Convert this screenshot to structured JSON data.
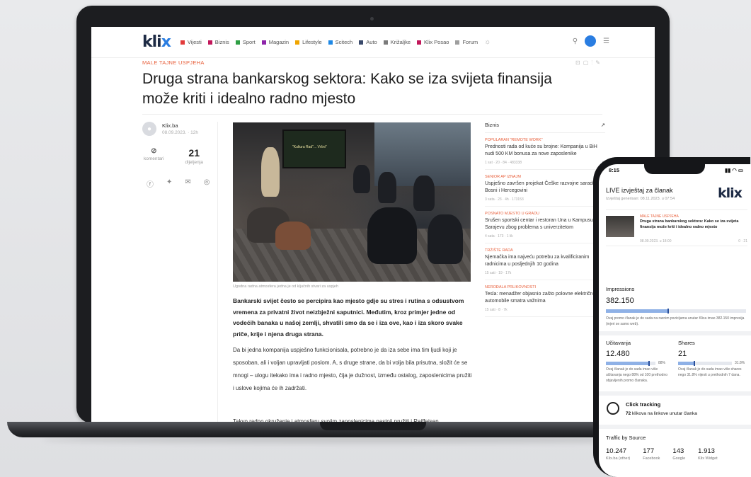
{
  "nav": {
    "logo_main": "kli",
    "logo_x": "x",
    "items": [
      {
        "label": "Vijesti",
        "color": "#e23b3b"
      },
      {
        "label": "Biznis",
        "color": "#c2185b"
      },
      {
        "label": "Sport",
        "color": "#2e9e44"
      },
      {
        "label": "Magazin",
        "color": "#8e24aa"
      },
      {
        "label": "Lifestyle",
        "color": "#f0a500"
      },
      {
        "label": "Scitech",
        "color": "#1e88e5"
      },
      {
        "label": "Auto",
        "color": "#3a4a6b"
      },
      {
        "label": "Križaljke",
        "color": "#7b7b7b"
      },
      {
        "label": "Klix Posao",
        "color": "#c2185b"
      },
      {
        "label": "Forum",
        "color": "#9e9e9e"
      }
    ]
  },
  "article": {
    "kicker": "MALE TAJNE USPJEHA",
    "headline": "Druga strana bankarskog sektora: Kako se iza svijeta finansija može kriti i idealno radno mjesto",
    "author": "Klix.ba",
    "date": "08.09.2023. · 12h",
    "comments_label": "komentari",
    "shares_count": "21",
    "shares_label": "dijeljenja",
    "photo_screen_text": "\"Kultura Rad\"... Vršni\"",
    "caption": "Ugodna radna atmosfera jedna je od ključnih stvari za uspjeh",
    "lead": "Bankarski svijet često se percipira kao mjesto gdje su stres i rutina s odsustvom vremena za privatni život neizbježni saputnici. Međutim, kroz primjer jedne od vodećih banaka u našoj zemlji, shvatili smo da se i iza ove, kao i iza skoro svake priče, krije i njena druga strana.",
    "body": "Da bi jedna kompanija uspješno funkcionisala, potrebno je da iza sebe ima tim ljudi koji je sposoban, ali i voljan upravljati poslom. A, s druge strane, da bi volja bila prisutna, složit će se mnogi – ulogu itekako ima i radno mjesto, čija je dužnost, između ostalog, zaposlenicima pružiti i uslove kojima će ih zadržati.",
    "body2": "Takvo radno okruženje i atmosferu svojim zaposlenicima nastoji pružiti i Raiffeisen"
  },
  "sidebar": {
    "title": "Biznis",
    "items": [
      {
        "kicker": "POPULARAN \"REMOTE WORK\"",
        "title": "Prednosti rada od kuće su brojne: Kompanija u BiH nudi 500 KM bonusa za nove zaposlenike",
        "meta": "1 sat · 20 · 84 · 483338"
      },
      {
        "kicker": "SENIOR AP IZNAJM",
        "title": "Uspješno završen projekat Češke razvojne saradnje u Bosni i Hercegovini",
        "meta": "3 sata · 23 · 4h · 173153"
      },
      {
        "kicker": "POSNATO MJESTO U GRADU",
        "title": "Srušen sportski centar i restoran Una u Kampusu u Sarajevu zbog problema s univerzitetom",
        "meta": "4 sata · 173 · 1 lik"
      },
      {
        "kicker": "TRŽIŠTE RADA",
        "title": "Njemačka ima najveću potrebu za kvalificiranim radnicima u posljednjih 10 godina",
        "meta": "15 sati · 19 · 17k"
      },
      {
        "kicker": "NEROĐALA PRLIKOVNOSTI",
        "title": "Tesla: menadžer objasnio zašto polovne električne automobile smatra važnima",
        "meta": "15 sati · 8 · 7k"
      }
    ]
  },
  "phone": {
    "time": "8:15",
    "title": "LIVE izvještaj za članak",
    "subtitle": "Izvještaj generisan: 08.11.2023. u 07:54",
    "logo": "klix",
    "card_kicker": "MALE TAJNE USPJEHA",
    "card_title": "Druga strana bankarskog sektora: Kako se iza svijeta finansija može kriti i idealno radno mjesto",
    "card_date": "08.09.2023. u 18:00",
    "card_count": "0 · 21",
    "impressions_label": "Impressions",
    "impressions_value": "382.150",
    "impressions_fill": 0.45,
    "impressions_note": "Ovaj promo članak je do sada na raznim pozicijama unutar Klixa imao 382.150 impresija (mjeri se samo web).",
    "loads_label": "Učitavanja",
    "loads_value": "12.480",
    "loads_fill": 0.88,
    "loads_pct": "88%",
    "loads_note": "Ovaj članak je do sada imao više učitavanja nego 88% od 100 prethodno objavljenih promo članaka.",
    "shares_label": "Shares",
    "shares_value": "21",
    "shares_fill": 0.318,
    "shares_pct": "31.8%",
    "shares_note": "Ovaj članak je do sada imao više shares nego 31.8% vijesti u prethodnih 7 dana.",
    "tracking_label": "Click tracking",
    "tracking_value": "72",
    "tracking_text": "klikova na linkove unutar članka",
    "traffic_label": "Traffic by Source",
    "traffic": [
      {
        "value": "10.247",
        "label": "Klix.ba (other)"
      },
      {
        "value": "177",
        "label": "Facebook"
      },
      {
        "value": "143",
        "label": "Google"
      },
      {
        "value": "1.913",
        "label": "Klix Widget"
      }
    ]
  }
}
